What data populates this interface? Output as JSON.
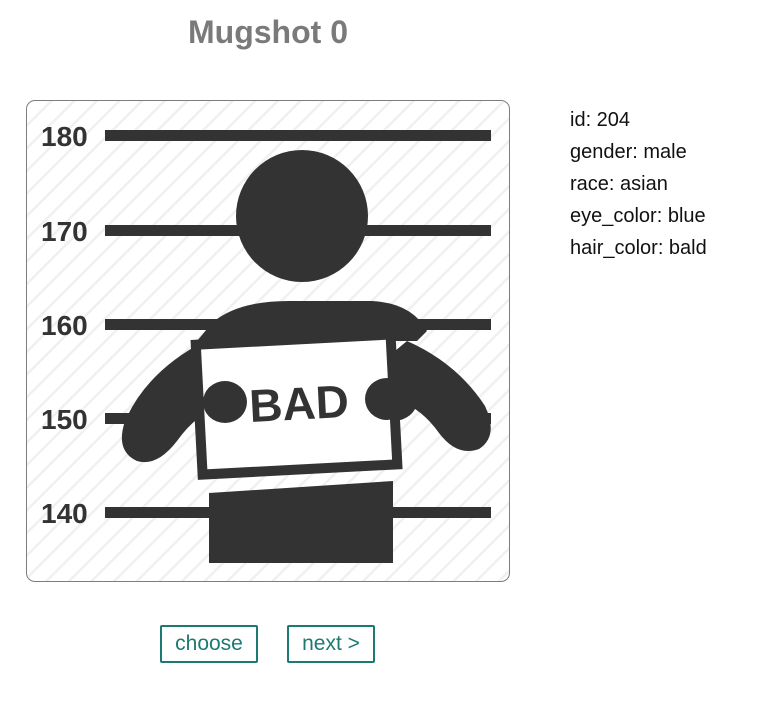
{
  "title": "Mugshot 0",
  "mugshot": {
    "height_marks": [
      "180",
      "170",
      "160",
      "150",
      "140"
    ],
    "sign_text": "BAD"
  },
  "details": {
    "id": "id: 204",
    "gender": "gender: male",
    "race": "race: asian",
    "eye_color": "eye_color: blue",
    "hair_color": "hair_color: bald"
  },
  "buttons": {
    "choose": "choose",
    "next": "next >"
  },
  "colors": {
    "title": "#7a7a7a",
    "figure": "#333333",
    "button_accent": "#1d7a72"
  }
}
